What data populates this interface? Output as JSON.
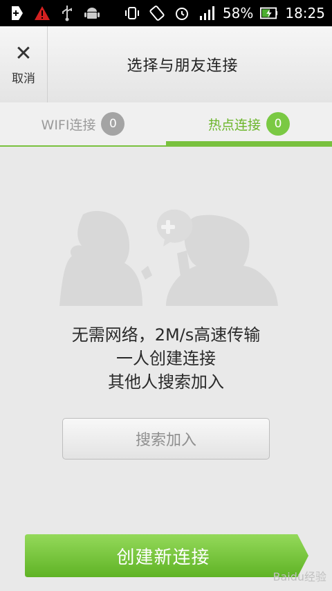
{
  "status_bar": {
    "battery": "58%",
    "time": "18:25"
  },
  "header": {
    "cancel_label": "取消",
    "title": "选择与朋友连接"
  },
  "tabs": [
    {
      "label": "WIFI连接",
      "count": "0",
      "active": false
    },
    {
      "label": "热点连接",
      "count": "0",
      "active": true
    }
  ],
  "main": {
    "line1": "无需网络，2M/s高速传输",
    "line2": "一人创建连接",
    "line3": "其他人搜索加入",
    "search_join_label": "搜索加入",
    "create_label": "创建新连接"
  },
  "watermark": "Baidu经验",
  "colors": {
    "accent_green": "#79c13e",
    "inactive_gray": "#a4a4a4"
  }
}
